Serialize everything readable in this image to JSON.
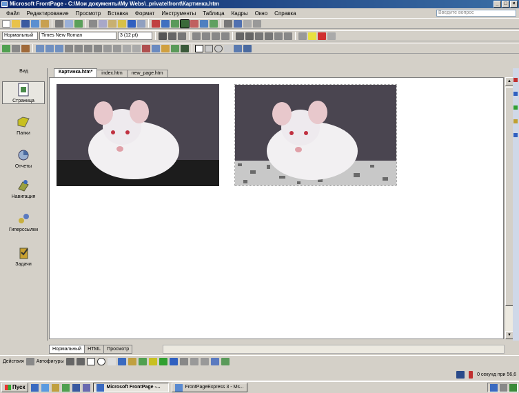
{
  "window": {
    "title": "Microsoft FrontPage - C:\\Мои документы\\My Webs\\_private\\front\\Картинка.htm",
    "controls": [
      "_",
      "□",
      "×"
    ]
  },
  "menubar": {
    "items": [
      "Файл",
      "Редактирование",
      "Просмотр",
      "Вставка",
      "Формат",
      "Инструменты",
      "Таблица",
      "Кадры",
      "Окно",
      "Справка"
    ],
    "help_placeholder": "Введите вопрос"
  },
  "formatting": {
    "style": "Нормальный",
    "font": "Times New Roman",
    "size": "3 (12 pt)"
  },
  "views": {
    "label": "Вид",
    "items": [
      {
        "label": "Страница",
        "icon": "page-view-icon",
        "selected": true
      },
      {
        "label": "Папки",
        "icon": "folders-view-icon",
        "selected": false
      },
      {
        "label": "Отчеты",
        "icon": "reports-view-icon",
        "selected": false
      },
      {
        "label": "Навигация",
        "icon": "navigation-view-icon",
        "selected": false
      },
      {
        "label": "Гиперссылки",
        "icon": "hyperlinks-view-icon",
        "selected": false
      },
      {
        "label": "Задачи",
        "icon": "tasks-view-icon",
        "selected": false
      }
    ]
  },
  "doc_tabs": [
    "Картинка.htm*",
    "index.htm",
    "new_page.htm"
  ],
  "view_tabs": [
    "Нормальный",
    "HTML",
    "Просмотр"
  ],
  "status": {
    "connection": "0 секунд при 56,6"
  },
  "taskbar": {
    "start_label": "Пуск",
    "tasks": [
      {
        "label": "Microsoft FrontPage -...",
        "active": true
      },
      {
        "label": "FrontPageExpress 3 - Ms...",
        "active": false
      }
    ]
  },
  "draw_labels": {
    "actions": "Действия",
    "autoshapes": "Автофигуры"
  },
  "colors": {
    "title_bar": "#0a246a",
    "workspace": "#ffffff",
    "chrome": "#d4d0c8"
  }
}
